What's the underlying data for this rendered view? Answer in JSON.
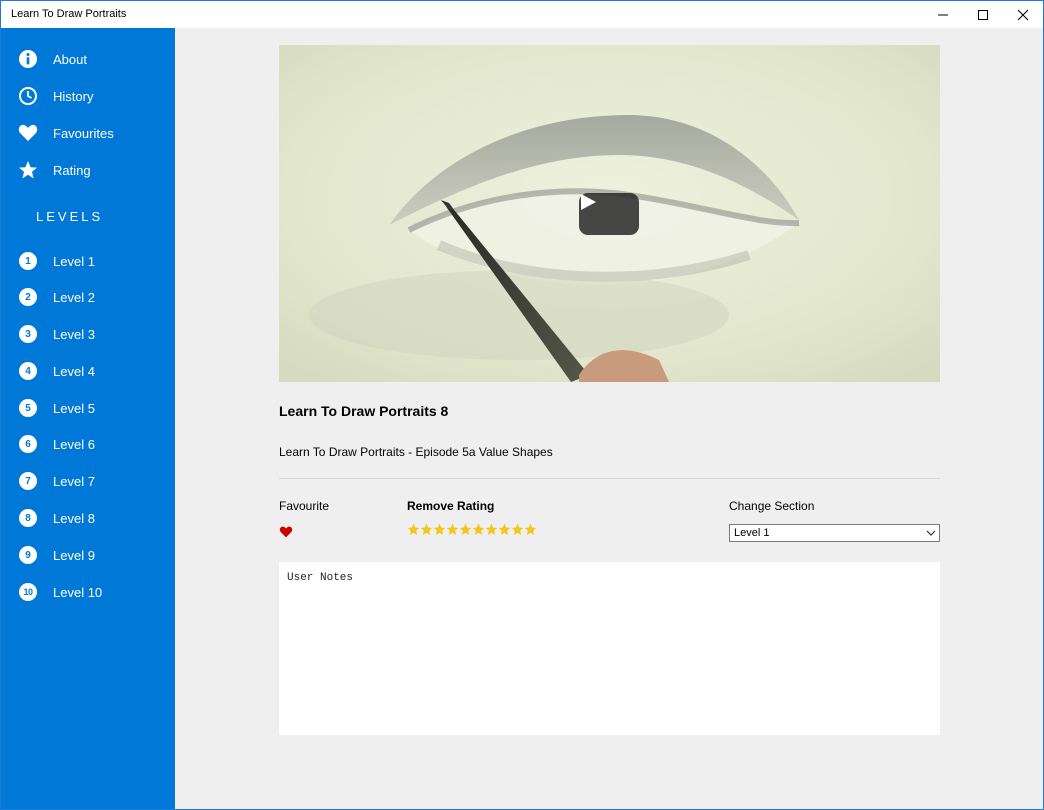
{
  "window": {
    "title": "Learn To Draw Portraits",
    "controls": [
      "minimize-icon",
      "maximize-icon",
      "close-icon"
    ]
  },
  "sidebar": {
    "menu": [
      {
        "label": "About",
        "icon": "info-icon"
      },
      {
        "label": "History",
        "icon": "clock-icon"
      },
      {
        "label": "Favourites",
        "icon": "heart-icon"
      },
      {
        "label": "Rating",
        "icon": "star-icon"
      }
    ],
    "levels_heading": "LEVELS",
    "levels": [
      {
        "label": "Level 1",
        "num": "1"
      },
      {
        "label": "Level 2",
        "num": "2"
      },
      {
        "label": "Level 3",
        "num": "3"
      },
      {
        "label": "Level 4",
        "num": "4"
      },
      {
        "label": "Level 5",
        "num": "5"
      },
      {
        "label": "Level 6",
        "num": "6"
      },
      {
        "label": "Level 7",
        "num": "7"
      },
      {
        "label": "Level 8",
        "num": "8"
      },
      {
        "label": "Level 9",
        "num": "9"
      },
      {
        "label": "Level 10",
        "num": "10"
      }
    ]
  },
  "video": {
    "thumbnail": "pencil drawing of an eye",
    "play_icon": "play-icon"
  },
  "content": {
    "title": "Learn To Draw Portraits 8",
    "description": "Learn To Draw Portraits - Episode 5a Value Shapes",
    "favourite_label": "Favourite",
    "favourite_state": true,
    "rating_label": "Remove Rating",
    "rating_value": 10,
    "rating_max": 10,
    "section_label": "Change Section",
    "section_selected": "Level 1",
    "notes_placeholder": "User Notes"
  },
  "colors": {
    "accent": "#0078d7",
    "heart": "#cc0000",
    "star": "#f5c518",
    "background": "#efefef"
  }
}
